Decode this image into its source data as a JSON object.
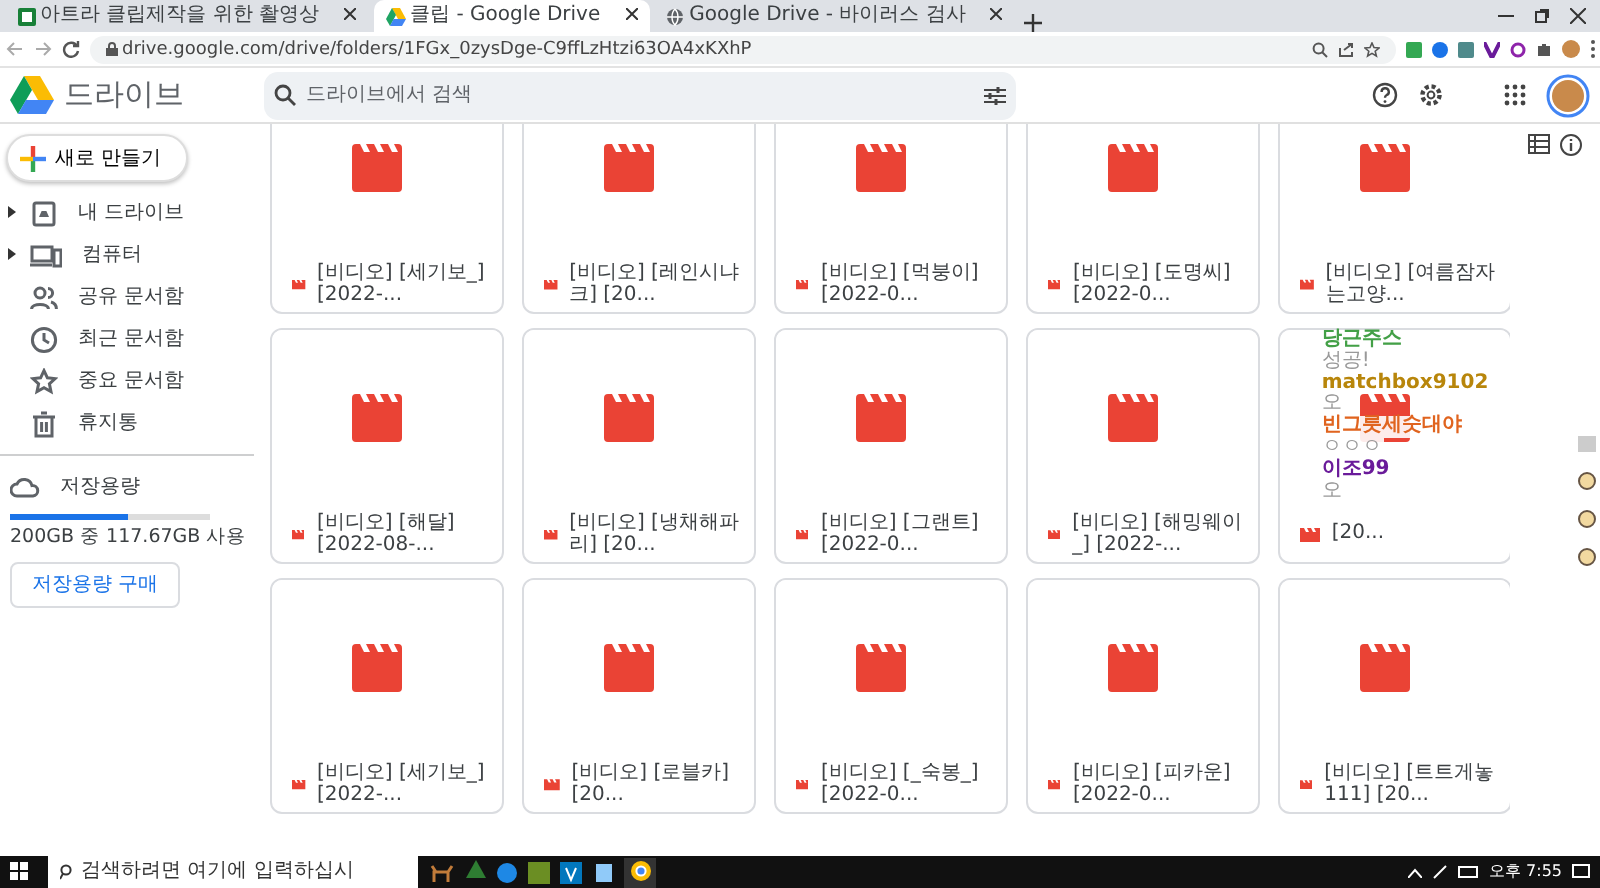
{
  "browser": {
    "tabs": [
      {
        "title": "아트라 클립제작을 위한 촬영상",
        "kind": "sheet",
        "selected": false
      },
      {
        "title": "클립 - Google Drive",
        "kind": "drive",
        "selected": true
      },
      {
        "title": "Google Drive - 바이러스 검사",
        "kind": "globe",
        "selected": false
      }
    ],
    "url": "drive.google.com/drive/folders/1FGx_0zysDge-C9ffLzHtzi63OA4xKXhP"
  },
  "app": {
    "name": "드라이브",
    "search_placeholder": "드라이브에서 검색"
  },
  "new_button": "새로 만들기",
  "sidebar": {
    "items": [
      {
        "label": "내 드라이브",
        "kind": "drive",
        "expandable": true
      },
      {
        "label": "컴퓨터",
        "kind": "computer",
        "expandable": true
      },
      {
        "label": "공유 문서함",
        "kind": "shared",
        "expandable": false
      },
      {
        "label": "최근 문서함",
        "kind": "recent",
        "expandable": false
      },
      {
        "label": "중요 문서함",
        "kind": "starred",
        "expandable": false
      },
      {
        "label": "휴지통",
        "kind": "trash",
        "expandable": false
      }
    ],
    "storage": {
      "label": "저장용량",
      "level": 0.59,
      "usage": "200GB 중 117.67GB 사용",
      "button": "저장용량 구매"
    }
  },
  "files": [
    {
      "name": "[비디오] [세기보_] [2022-..."
    },
    {
      "name": "[비디오] [레인시냐크] [20..."
    },
    {
      "name": "[비디오] [먹붕이] [2022-0..."
    },
    {
      "name": "[비디오] [도명씨] [2022-0..."
    },
    {
      "name": "[비디오] [여름잠자는고양..."
    },
    {
      "name": "[비디오] [해달] [2022-08-..."
    },
    {
      "name": "[비디오] [냉채해파리] [20..."
    },
    {
      "name": "[비디오] [그랜트] [2022-0..."
    },
    {
      "name": "[비디오] [해밍웨이_] [2022-..."
    },
    {
      "name": "[20..."
    },
    {
      "name": "[비디오] [세기보_] [2022-..."
    },
    {
      "name": "[비디오] [로블카] [20..."
    },
    {
      "name": "[비디오] [_숙봉_] [2022-0..."
    },
    {
      "name": "[비디오] [피카운] [2022-0..."
    },
    {
      "name": "[비디오] [트트게놓111] [20..."
    }
  ],
  "chat": [
    {
      "user": "당근주스",
      "message": "성공!",
      "color": "#43a047"
    },
    {
      "user": "matchbox9102",
      "message": "오",
      "color": "#b8860b"
    },
    {
      "user": "빈그릇세숫대야",
      "message": "ㅇㅇㅇ",
      "color": "#e0641f"
    },
    {
      "user": "이조99",
      "message": "오",
      "color": "#6a1b9a"
    }
  ],
  "taskbar": {
    "search_placeholder": "검색하려면 여기에 입력하십시",
    "time": "오후 7:55"
  }
}
